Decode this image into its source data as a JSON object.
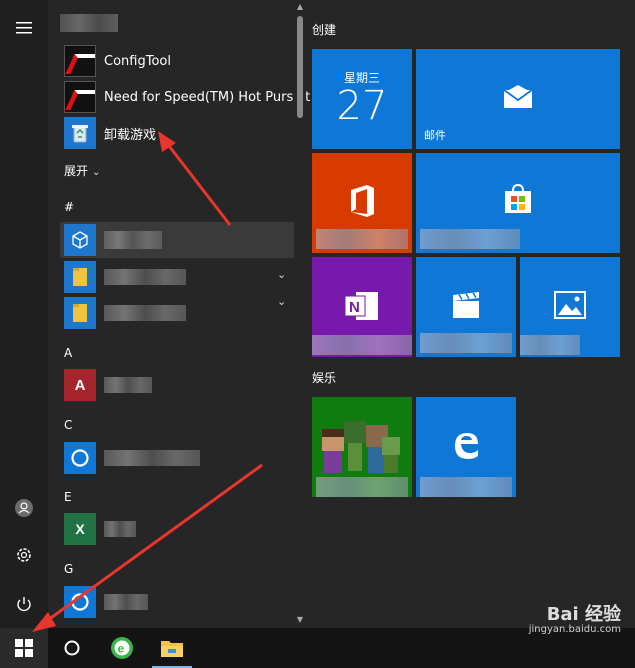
{
  "applist": {
    "apps": [
      {
        "name": "configtool",
        "label": "ConfigTool"
      },
      {
        "name": "nfs-hot-pursuit",
        "label": "Need for Speed(TM) Hot Pursuit"
      },
      {
        "name": "uninstall-game",
        "label": "卸载游戏"
      }
    ],
    "expand_label": "展开",
    "headers": {
      "hash": "#",
      "a": "A",
      "c": "C",
      "e": "E",
      "g": "G"
    }
  },
  "tiles": {
    "group1_title": "创建",
    "group2_title": "娱乐",
    "calendar": {
      "day": "星期三",
      "date": "27"
    },
    "mail_label": "邮件"
  },
  "watermark": {
    "main": "Bai 经验",
    "sub": "jingyan.baidu.com"
  },
  "colors": {
    "tile_blue": "#0f78d7",
    "office_orange": "#d83b01",
    "onenote_purple": "#7719aa",
    "xbox_green": "#107c10",
    "annotation_red": "#e8362d"
  }
}
